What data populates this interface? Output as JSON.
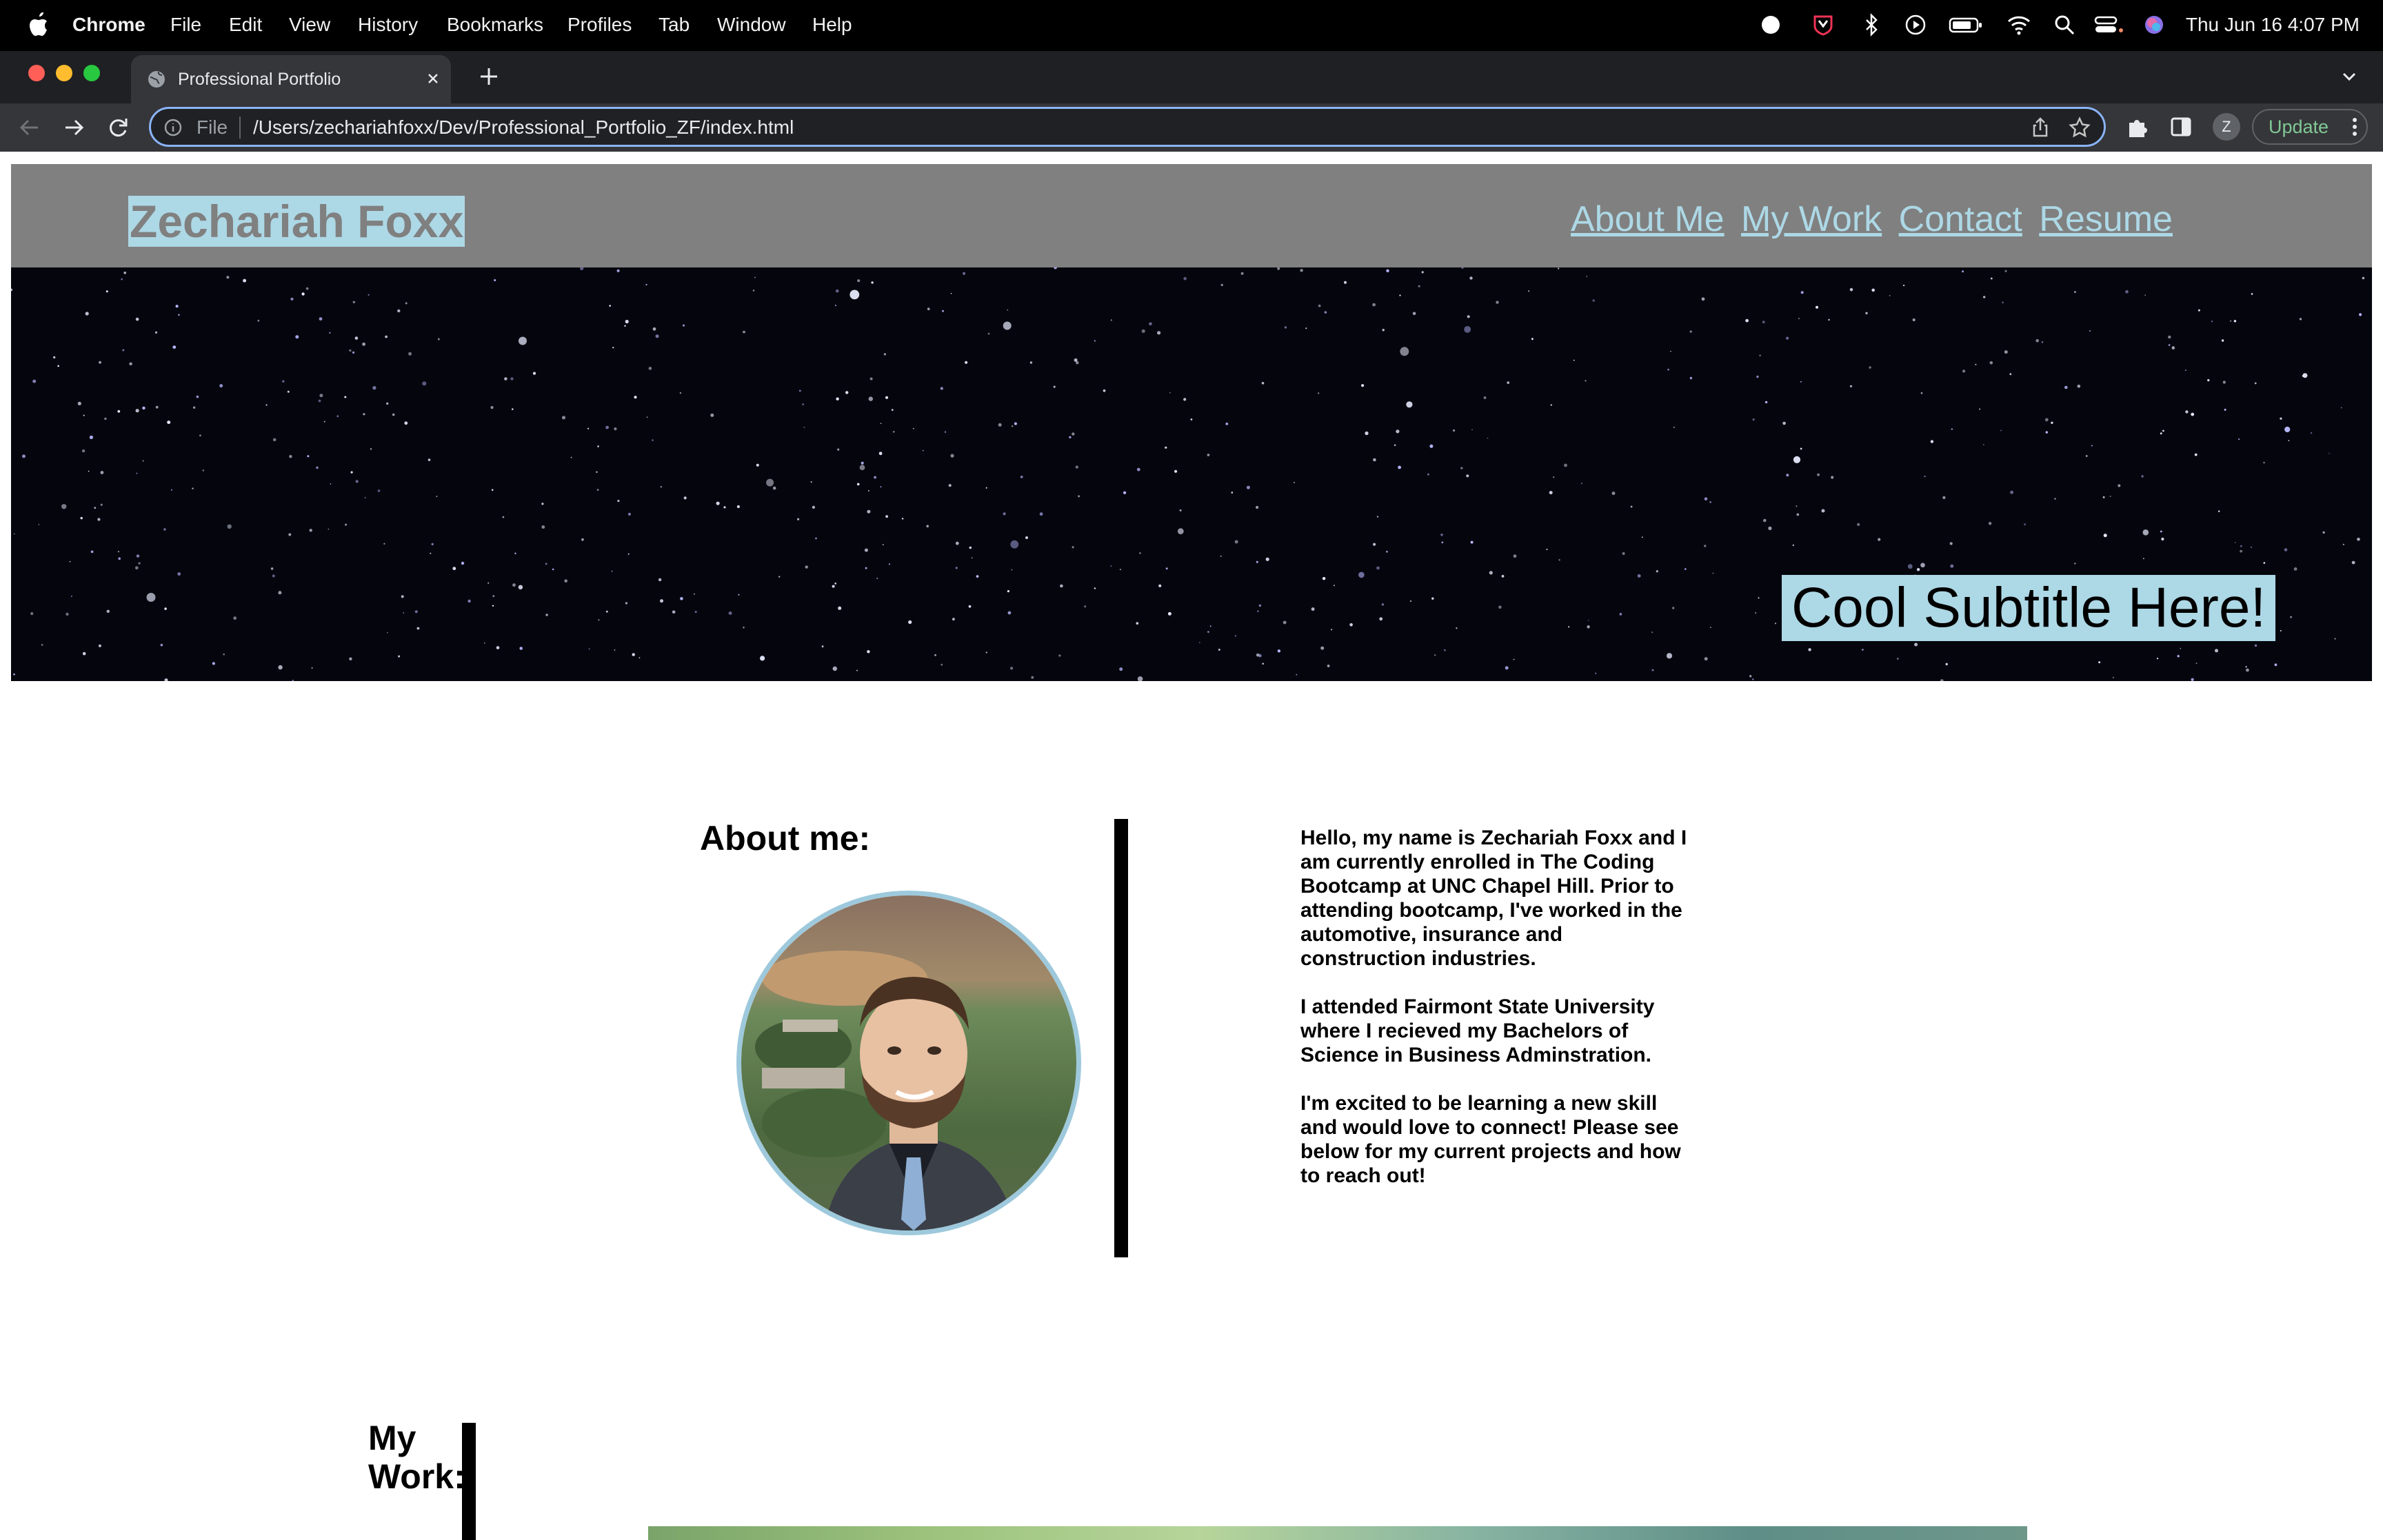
{
  "menubar": {
    "app_name": "Chrome",
    "items": [
      "File",
      "Edit",
      "View",
      "History",
      "Bookmarks",
      "Profiles",
      "Tab",
      "Window",
      "Help"
    ],
    "clock": "Thu Jun 16  4:07 PM"
  },
  "browser": {
    "tab_title": "Professional Portfolio",
    "url_scheme": "File",
    "url": "/Users/zechariahfoxx/Dev/Professional_Portfolio_ZF/index.html",
    "profile_initial": "Z",
    "update_label": "Update"
  },
  "site": {
    "title": "Zechariah Foxx",
    "nav": [
      "About Me",
      "My Work",
      "Contact",
      "Resume"
    ],
    "subtitle": "Cool Subtitle Here!",
    "about_heading": "About me:",
    "about_paragraphs": [
      "Hello, my name is Zechariah Foxx and I am currently enrolled in The Coding Bootcamp at UNC Chapel Hill. Prior to attending bootcamp, I've worked in the automotive, insurance and construction industries.",
      "I attended Fairmont State University where I recieved my Bachelors of Science in Business Adminstration.",
      "I'm excited to be learning a new skill and would love to connect! Please see below for my current projects and how to reach out!"
    ],
    "work_heading": "My Work:"
  },
  "colors": {
    "header_bg": "#808080",
    "accent_light_blue": "#add8e6",
    "omnibox_focus": "#8ab4f8",
    "update_green": "#81c995"
  }
}
